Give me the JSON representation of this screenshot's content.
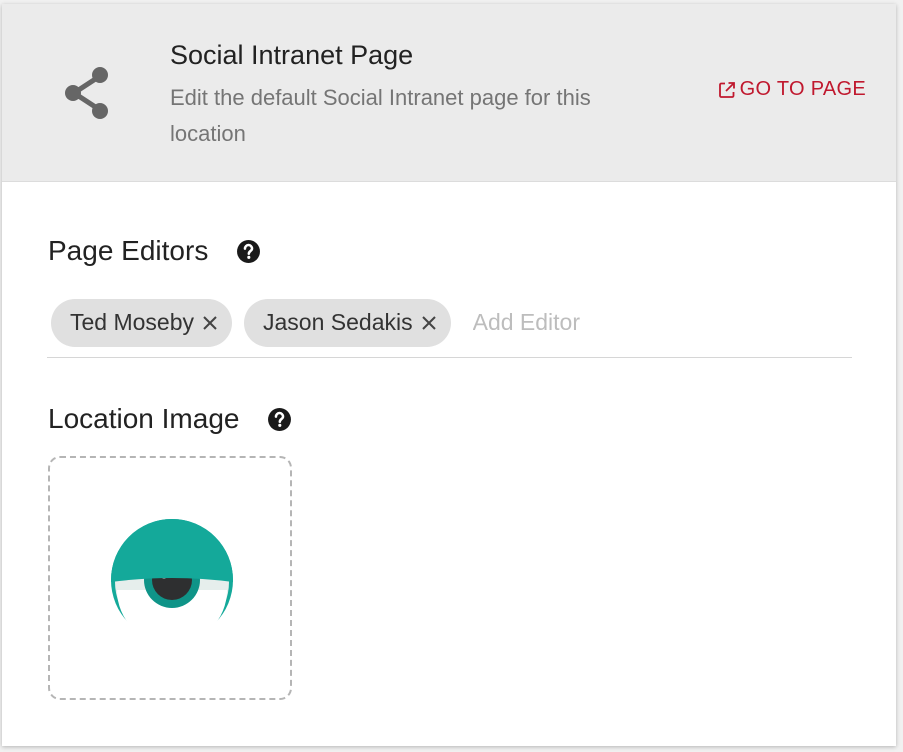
{
  "header": {
    "title": "Social Intranet Page",
    "description": "Edit the default Social Intranet page for this location",
    "icon": "share-icon",
    "goto_label": "GO TO PAGE",
    "goto_icon": "external-link-icon",
    "accent_color": "#c0182e"
  },
  "editors": {
    "label": "Page Editors",
    "help_icon": "help-circle-icon",
    "chips": [
      {
        "name": "Ted Moseby"
      },
      {
        "name": "Jason Sedakis"
      }
    ],
    "placeholder": "Add Editor"
  },
  "location_image": {
    "label": "Location Image",
    "help_icon": "help-circle-icon",
    "logo": "eye-logo",
    "logo_color": "#14a99a"
  }
}
